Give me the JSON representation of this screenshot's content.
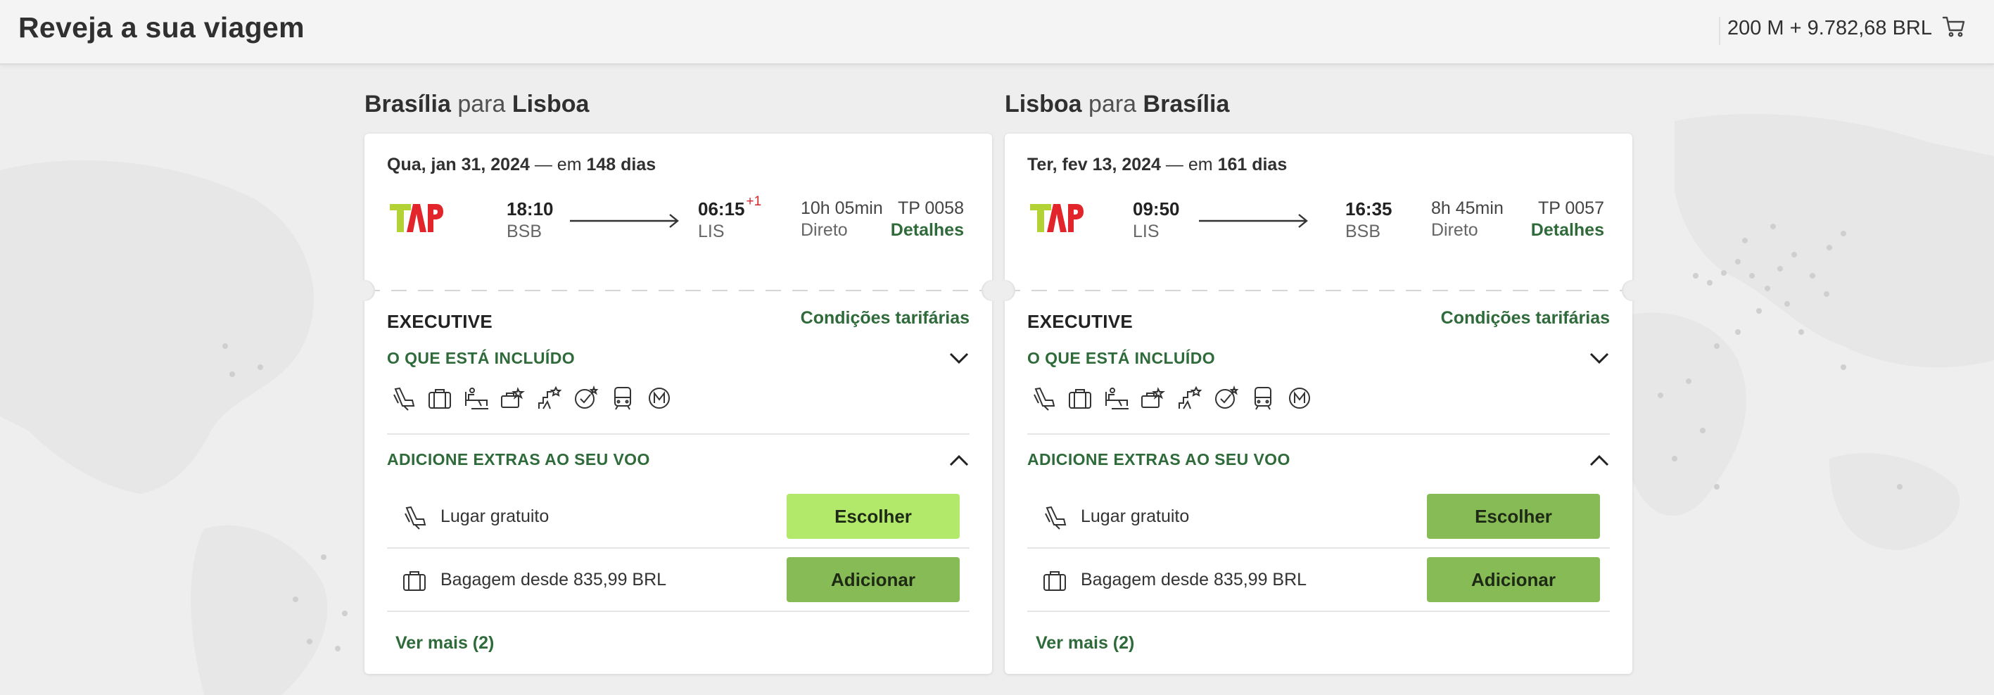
{
  "header": {
    "title": "Reveja a sua viagem",
    "cart_total": "200 M + 9.782,68 BRL",
    "cart_icon": "cart-icon"
  },
  "colors": {
    "brand_green": "#2f6b3a",
    "button_green": "#86bb55",
    "button_light_green": "#b2e96a",
    "next_day_red": "#d3272c"
  },
  "outbound": {
    "origin": "Brasília",
    "connector": "para",
    "destination": "Lisboa",
    "date": "Qua, jan 31, 2024",
    "in_label": "— em",
    "days": "148 dias",
    "dep_time": "18:10",
    "dep_code": "BSB",
    "arr_time": "06:15",
    "arr_plus": "+1",
    "arr_code": "LIS",
    "duration": "10h 05min",
    "stops": "Direto",
    "flight_no": "TP 0058",
    "details": "Detalhes",
    "cabin": "EXECUTIVE",
    "fare_conditions": "Condições tarifárias",
    "included_title": "O QUE ESTÁ INCLUÍDO",
    "extras_title": "ADICIONE EXTRAS AO SEU VOO",
    "extras": [
      {
        "label": "Lugar gratuito",
        "button": "Escolher",
        "icon": "seat-icon",
        "highlight": true
      },
      {
        "label": "Bagagem desde 835,99 BRL",
        "button": "Adicionar",
        "icon": "baggage-icon",
        "highlight": false
      }
    ],
    "see_more": "Ver mais (2)"
  },
  "inbound": {
    "origin": "Lisboa",
    "connector": "para",
    "destination": "Brasília",
    "date": "Ter, fev 13, 2024",
    "in_label": "— em",
    "days": "161 dias",
    "dep_time": "09:50",
    "dep_code": "LIS",
    "arr_time": "16:35",
    "arr_code": "BSB",
    "duration": "8h 45min",
    "stops": "Direto",
    "flight_no": "TP 0057",
    "details": "Detalhes",
    "cabin": "EXECUTIVE",
    "fare_conditions": "Condições tarifárias",
    "included_title": "O QUE ESTÁ INCLUÍDO",
    "extras_title": "ADICIONE EXTRAS AO SEU VOO",
    "extras": [
      {
        "label": "Lugar gratuito",
        "button": "Escolher",
        "icon": "seat-icon",
        "highlight": false
      },
      {
        "label": "Bagagem desde 835,99 BRL",
        "button": "Adicionar",
        "icon": "baggage-icon",
        "highlight": false
      }
    ],
    "see_more": "Ver mais (2)"
  },
  "included_icons": [
    "seat-icon",
    "carry-on-bag-icon",
    "lounge-icon",
    "priority-checkin-icon",
    "fast-track-icon",
    "miles-icon",
    "transfer-icon",
    "metro-icon"
  ]
}
